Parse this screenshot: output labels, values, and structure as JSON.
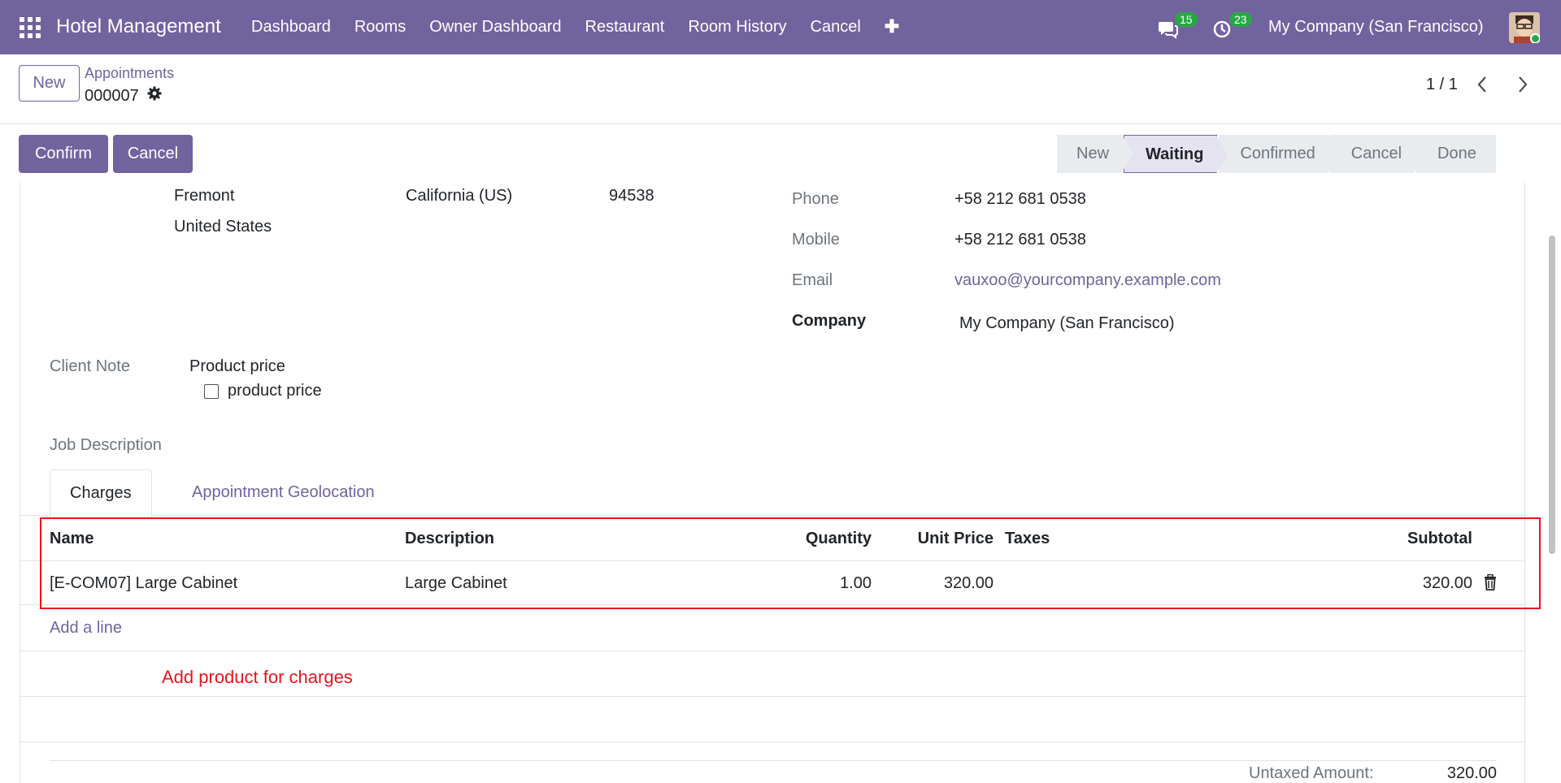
{
  "nav": {
    "brand": "Hotel Management",
    "menu": [
      "Dashboard",
      "Rooms",
      "Owner Dashboard",
      "Restaurant",
      "Room History",
      "Cancel"
    ],
    "plus": "✚",
    "chat_badge": "15",
    "activity_badge": "23",
    "company": "My Company (San Francisco)"
  },
  "control_panel": {
    "new_label": "New",
    "breadcrumb": "Appointments",
    "record_name": "000007",
    "pager": "1 / 1"
  },
  "statusbar": {
    "confirm_label": "Confirm",
    "cancel_label": "Cancel",
    "stages": [
      "New",
      "Waiting",
      "Confirmed",
      "Cancel",
      "Done"
    ],
    "active_stage": "Waiting"
  },
  "address": {
    "city": "Fremont",
    "state": "California (US)",
    "zip": "94538",
    "country": "United States"
  },
  "contact": {
    "phone_label": "Phone",
    "phone": "+58 212 681 0538",
    "mobile_label": "Mobile",
    "mobile": "+58 212 681 0538",
    "email_label": "Email",
    "email": "vauxoo@yourcompany.example.com",
    "company_label": "Company",
    "company": "My Company (San Francisco)"
  },
  "client_note": {
    "label": "Client Note",
    "title": "Product price",
    "checkbox_label": "product price"
  },
  "job_description_label": "Job Description",
  "tabs": [
    "Charges",
    "Appointment Geolocation"
  ],
  "charges": {
    "headers": {
      "name": "Name",
      "description": "Description",
      "quantity": "Quantity",
      "unit_price": "Unit Price",
      "taxes": "Taxes",
      "subtotal": "Subtotal"
    },
    "rows": [
      {
        "name": "[E-COM07] Large Cabinet",
        "description": "Large Cabinet",
        "quantity": "1.00",
        "unit_price": "320.00",
        "taxes": "",
        "subtotal": "320.00"
      }
    ],
    "add_line": "Add a line",
    "annotation": "Add product for charges"
  },
  "totals": {
    "untaxed_label": "Untaxed Amount:",
    "untaxed_value": "320.00"
  },
  "colors": {
    "brand": "#71639e",
    "highlight": "#e8141c",
    "badge": "#28a745"
  }
}
